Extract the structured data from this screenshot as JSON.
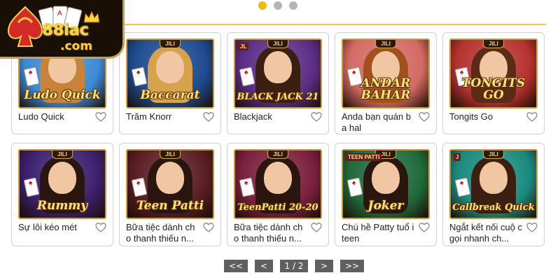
{
  "brand": {
    "name": "88iac",
    "domain": ".com"
  },
  "carousel": {
    "dots": [
      true,
      false,
      false
    ]
  },
  "games": [
    {
      "title": "Ludo Quick",
      "art": "Ludo Quick",
      "bg": "#3d8ad6",
      "hair": "#c7823b",
      "badge": ""
    },
    {
      "title": "Trăm Knorr",
      "art": "Baccarat",
      "bg": "#1d4b8f",
      "hair": "#d8a24c",
      "badge": ""
    },
    {
      "title": "Blackjack",
      "art": "BLACK JACK 21",
      "bg": "#5b2d86",
      "hair": "#3a1f12",
      "badge": "JL"
    },
    {
      "title": "Anda bạn quán b a hal",
      "art": "ANDAR BAHAR",
      "bg": "#d36a63",
      "hair": "#a44f20",
      "badge": ""
    },
    {
      "title": "Tongits Go",
      "art": "TONGITS GO",
      "bg": "#b6322f",
      "hair": "#5b2b16",
      "badge": ""
    },
    {
      "title": "Sự lôi kéo mét",
      "art": "Rummy",
      "bg": "#3b1f6d",
      "hair": "#2a160e",
      "badge": ""
    },
    {
      "title": "Bữa tiệc dành ch o thanh thiếu n...",
      "art": "Teen Patti",
      "bg": "#5a1d22",
      "hair": "#2a160e",
      "badge": ""
    },
    {
      "title": "Bữa tiệc dành ch o thanh thiếu n...",
      "art": "TeenPatti 20-20",
      "bg": "#7b1f3e",
      "hair": "#2a160e",
      "badge": ""
    },
    {
      "title": "Chú hề Patty tuổ i teen",
      "art": "Joker",
      "bg": "#1f6a3c",
      "hair": "#2a160e",
      "badge": "TEEN PATTI"
    },
    {
      "title": "Ngắt kết nối cuộ c gọi nhanh ch...",
      "art": "Callbreak Quick",
      "bg": "#1a8a7e",
      "hair": "#3a1f12",
      "badge": "J"
    }
  ],
  "pagination": {
    "first": "<<",
    "prev": "<",
    "page": "1 / 2",
    "next": ">",
    "last": ">>"
  }
}
